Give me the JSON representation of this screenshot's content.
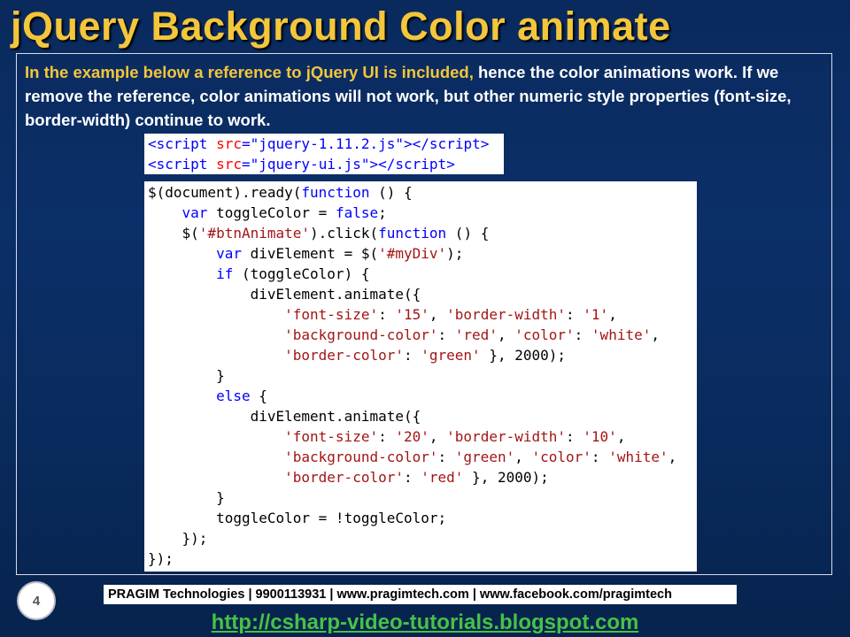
{
  "slide": {
    "title": "jQuery Background Color animate",
    "intro_highlight": "In the example below a reference to jQuery UI is included,",
    "intro_rest": " hence the color animations work. If we remove the reference, color animations will not work, but other numeric style properties (font-size, border-width) continue to work.",
    "page_number": "4"
  },
  "code_refs": [
    {
      "src": "jquery-1.11.2.js"
    },
    {
      "src": "jquery-ui.js"
    }
  ],
  "code_main": [
    "$(document).ready(function () {",
    "    var toggleColor = false;",
    "    $('#btnAnimate').click(function () {",
    "        var divElement = $('#myDiv');",
    "        if (toggleColor) {",
    "            divElement.animate({",
    "                'font-size': '15', 'border-width': '1',",
    "                'background-color': 'red', 'color': 'white',",
    "                'border-color': 'green' }, 2000);",
    "        }",
    "        else {",
    "            divElement.animate({",
    "                'font-size': '20', 'border-width': '10',",
    "                'background-color': 'green', 'color': 'white',",
    "                'border-color': 'red' }, 2000);",
    "        }",
    "        toggleColor = !toggleColor;",
    "    });",
    "});"
  ],
  "footer": {
    "company_line": "PRAGIM Technologies | 9900113931 | www.pragimtech.com | www.facebook.com/pragimtech",
    "link": "http://csharp-video-tutorials.blogspot.com"
  },
  "colors": {
    "title": "#f3c63b",
    "background": "#0a2a5e",
    "link": "#46c246",
    "keyword": "#0000ff",
    "string": "#a31515"
  }
}
